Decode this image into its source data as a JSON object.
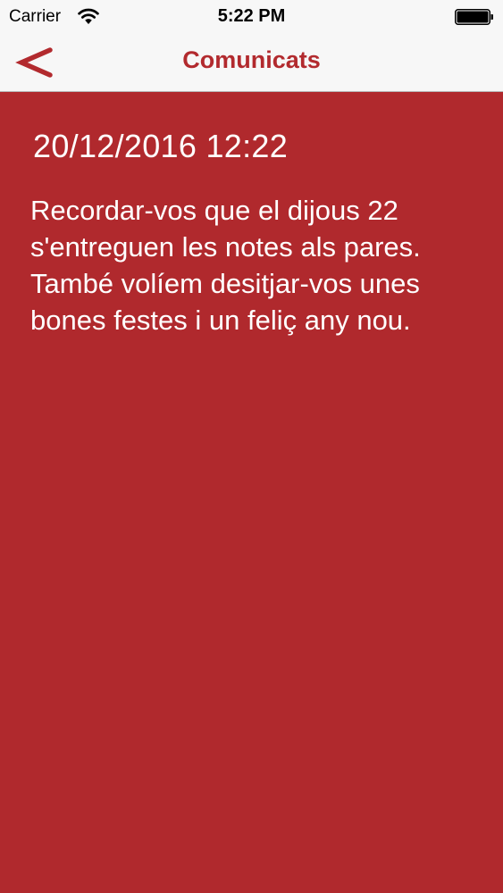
{
  "status_bar": {
    "carrier": "Carrier",
    "time": "5:22 PM",
    "wifi_icon": "wifi-icon",
    "battery_icon": "battery-full-icon"
  },
  "nav_bar": {
    "back_icon": "chevron-left-icon",
    "title": "Comunicats"
  },
  "message": {
    "date": "20/12/2016 12:22",
    "body": "Recordar-vos que el dijous 22\ns'entreguen les notes als pares.\nTambé volíem desitjar-vos unes\nbones festes i un feliç any nou."
  },
  "colors": {
    "accent": "#b22a2e",
    "background": "#b0292d",
    "text": "#ffffff",
    "nav_background": "#f7f7f7"
  }
}
